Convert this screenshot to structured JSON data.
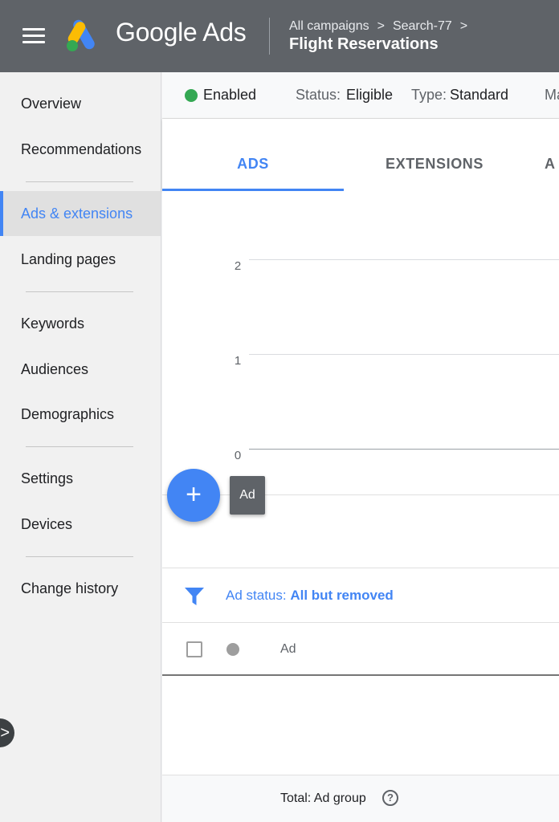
{
  "header": {
    "brand": "Google Ads",
    "breadcrumb": [
      "All campaigns",
      "Search-77"
    ],
    "breadcrumb_separator": ">",
    "campaign_title": "Flight Reservations"
  },
  "sidebar": {
    "items": [
      {
        "label": "Overview",
        "active": false
      },
      {
        "label": "Recommendations",
        "active": false
      },
      {
        "label": "Ads & extensions",
        "active": true
      },
      {
        "label": "Landing pages",
        "active": false
      },
      {
        "label": "Keywords",
        "active": false
      },
      {
        "label": "Audiences",
        "active": false
      },
      {
        "label": "Demographics",
        "active": false
      },
      {
        "label": "Settings",
        "active": false
      },
      {
        "label": "Devices",
        "active": false
      },
      {
        "label": "Change history",
        "active": false
      }
    ],
    "collapse_glyph": ">"
  },
  "status_bar": {
    "enabled_label": "Enabled",
    "status_label": "Status:",
    "status_value": "Eligible",
    "type_label": "Type:",
    "type_value": "Standard",
    "truncated": "Ma"
  },
  "tabs": [
    {
      "label": "ADS",
      "active": true
    },
    {
      "label": "EXTENSIONS",
      "active": false
    },
    {
      "label": "A",
      "active": false
    }
  ],
  "chart": {
    "y_ticks": [
      "2",
      "1",
      "0"
    ]
  },
  "fab": {
    "glyph": "+",
    "tooltip": "Ad"
  },
  "filter": {
    "label": "Ad status:",
    "value": "All but removed"
  },
  "table": {
    "columns": [
      "Ad"
    ]
  },
  "totals": {
    "label": "Total: Ad group",
    "help_glyph": "?"
  },
  "colors": {
    "header_bg": "#5f6368",
    "accent": "#4285f4",
    "enabled_green": "#34a853"
  }
}
